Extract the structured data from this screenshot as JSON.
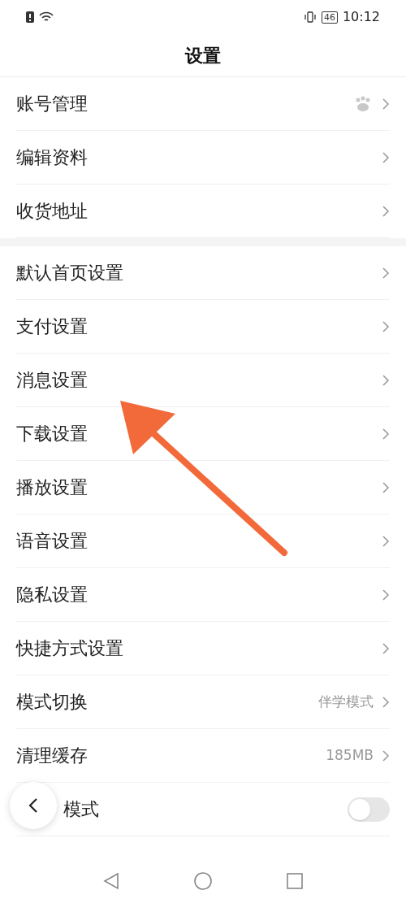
{
  "status_bar": {
    "battery": "46",
    "time": "10:12"
  },
  "title": "设置",
  "groups": [
    {
      "items": [
        {
          "label": "账号管理",
          "kind": "account"
        },
        {
          "label": "编辑资料",
          "kind": "link"
        },
        {
          "label": "收货地址",
          "kind": "link"
        }
      ]
    },
    {
      "items": [
        {
          "label": "默认首页设置",
          "kind": "link"
        },
        {
          "label": "支付设置",
          "kind": "link"
        },
        {
          "label": "消息设置",
          "kind": "link"
        },
        {
          "label": "下载设置",
          "kind": "link"
        },
        {
          "label": "播放设置",
          "kind": "link"
        },
        {
          "label": "语音设置",
          "kind": "link"
        },
        {
          "label": "隐私设置",
          "kind": "link"
        },
        {
          "label": "快捷方式设置",
          "kind": "link"
        },
        {
          "label": "模式切换",
          "kind": "link",
          "value": "伴学模式"
        },
        {
          "label": "清理缓存",
          "kind": "link",
          "value": "185MB"
        },
        {
          "label": "模式",
          "kind": "toggle",
          "on": false
        }
      ]
    }
  ]
}
